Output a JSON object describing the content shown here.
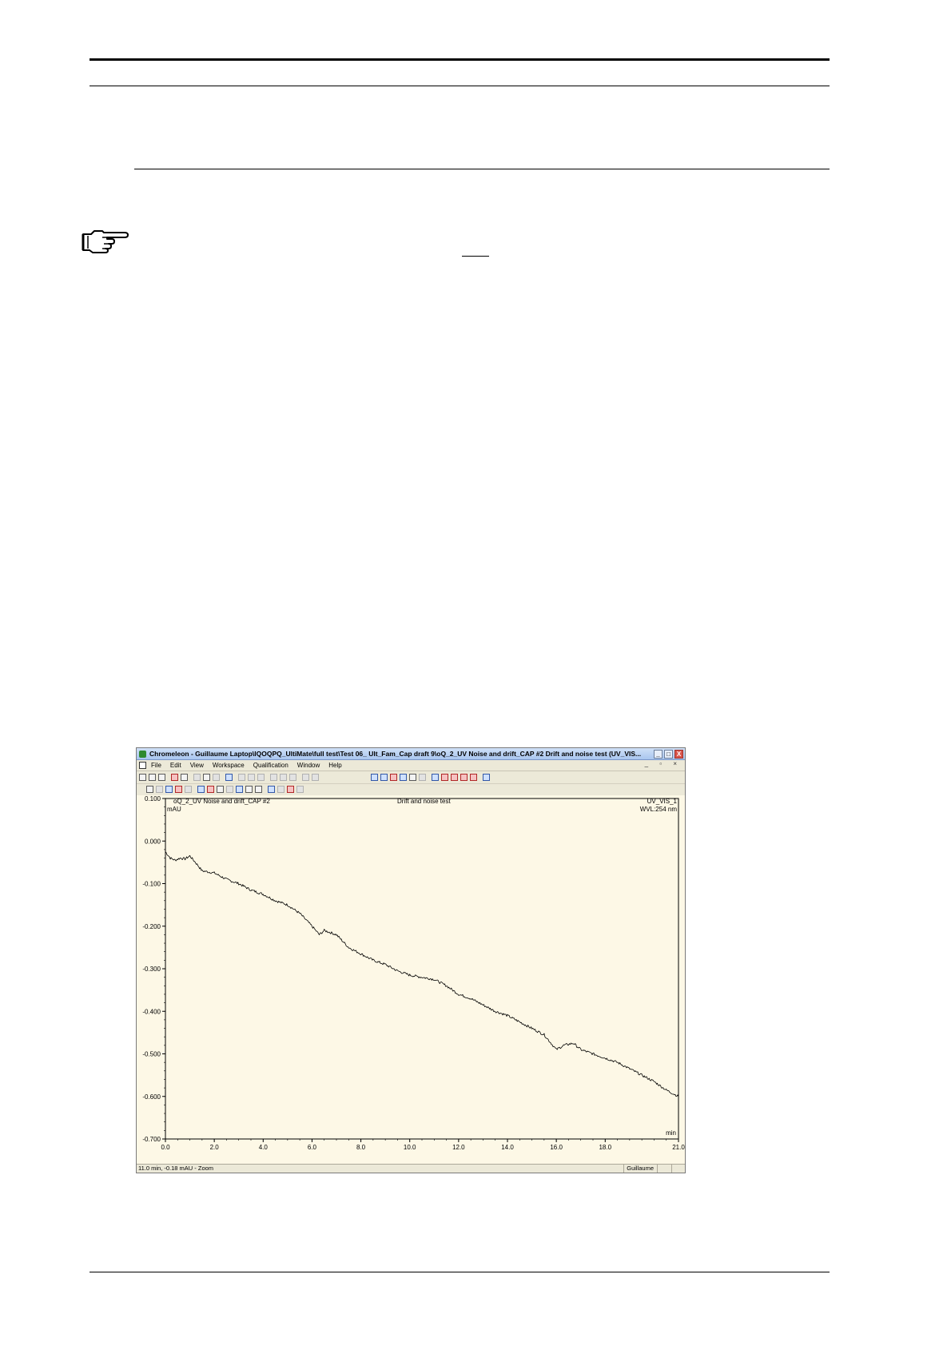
{
  "app": {
    "title": "Chromeleon - Guillaume Laptop\\IQOQPQ_UltiMate\\full test\\Test 06_    Ult_Fam_Cap draft 9\\oQ_2_UV Noise and drift_CAP #2 Drift  and noise test (UV_VIS...",
    "window_buttons": {
      "minimize": "_",
      "maximize": "□",
      "close": "X"
    },
    "mdi_controls": "_ ▫ ×"
  },
  "menu": [
    "File",
    "Edit",
    "View",
    "Workspace",
    "Qualification",
    "Window",
    "Help"
  ],
  "icons": {
    "note": "pointing-hand-icon",
    "app": "chromeleon-app-icon",
    "document": "chromatogram-doc-icon"
  },
  "chart_header": {
    "sample": "oQ_2_UV Noise and drift_CAP #2",
    "program": "Drift  and noise test",
    "channel": "UV_VIS_1",
    "wavelength": "WVL:254 nm"
  },
  "status": {
    "text": "11.0 min, -0.18 mAU - Zoom",
    "user": "Guillaume"
  },
  "colors": {
    "plot_background": "#fdf8e6",
    "trace": "#000000",
    "title_bar": "#a9c6ef"
  },
  "chart_data": {
    "type": "line",
    "xlabel": "min",
    "ylabel": "mAU",
    "xlim": [
      0.0,
      21.0
    ],
    "ylim": [
      -0.7,
      0.1
    ],
    "x_ticks": [
      "0.0",
      "2.0",
      "4.0",
      "6.0",
      "8.0",
      "10.0",
      "12.0",
      "14.0",
      "16.0",
      "18.0",
      "21.0"
    ],
    "x_tick_values": [
      0,
      2,
      4,
      6,
      8,
      10,
      12,
      14,
      16,
      18,
      21
    ],
    "y_ticks": [
      "0.100",
      "0.000",
      "-0.100",
      "-0.200",
      "-0.300",
      "-0.400",
      "-0.500",
      "-0.600",
      "-0.700"
    ],
    "y_tick_values": [
      0.1,
      0.0,
      -0.1,
      -0.2,
      -0.3,
      -0.4,
      -0.5,
      -0.6,
      -0.7
    ],
    "grid": false,
    "series": [
      {
        "x": [
          0.0,
          0.2,
          0.4,
          0.6,
          0.8,
          1.0,
          1.3,
          1.5,
          2.0,
          2.5,
          3.0,
          3.5,
          4.0,
          4.5,
          5.0,
          5.5,
          6.0,
          6.3,
          6.5,
          7.0,
          7.5,
          8.0,
          8.5,
          9.0,
          9.5,
          10.0,
          10.5,
          11.0,
          11.5,
          12.0,
          12.5,
          13.0,
          13.5,
          14.0,
          14.5,
          15.0,
          15.5,
          16.0,
          16.3,
          16.7,
          17.0,
          17.5,
          18.0,
          18.5,
          19.0,
          19.5,
          20.0,
          20.5,
          21.0
        ],
        "values": [
          -0.025,
          -0.04,
          -0.045,
          -0.04,
          -0.042,
          -0.035,
          -0.055,
          -0.07,
          -0.075,
          -0.09,
          -0.1,
          -0.115,
          -0.125,
          -0.14,
          -0.15,
          -0.17,
          -0.2,
          -0.22,
          -0.21,
          -0.22,
          -0.25,
          -0.265,
          -0.28,
          -0.29,
          -0.305,
          -0.315,
          -0.32,
          -0.325,
          -0.34,
          -0.36,
          -0.37,
          -0.385,
          -0.4,
          -0.41,
          -0.425,
          -0.44,
          -0.455,
          -0.49,
          -0.48,
          -0.475,
          -0.49,
          -0.5,
          -0.51,
          -0.52,
          -0.535,
          -0.55,
          -0.565,
          -0.585,
          -0.6
        ]
      }
    ]
  }
}
